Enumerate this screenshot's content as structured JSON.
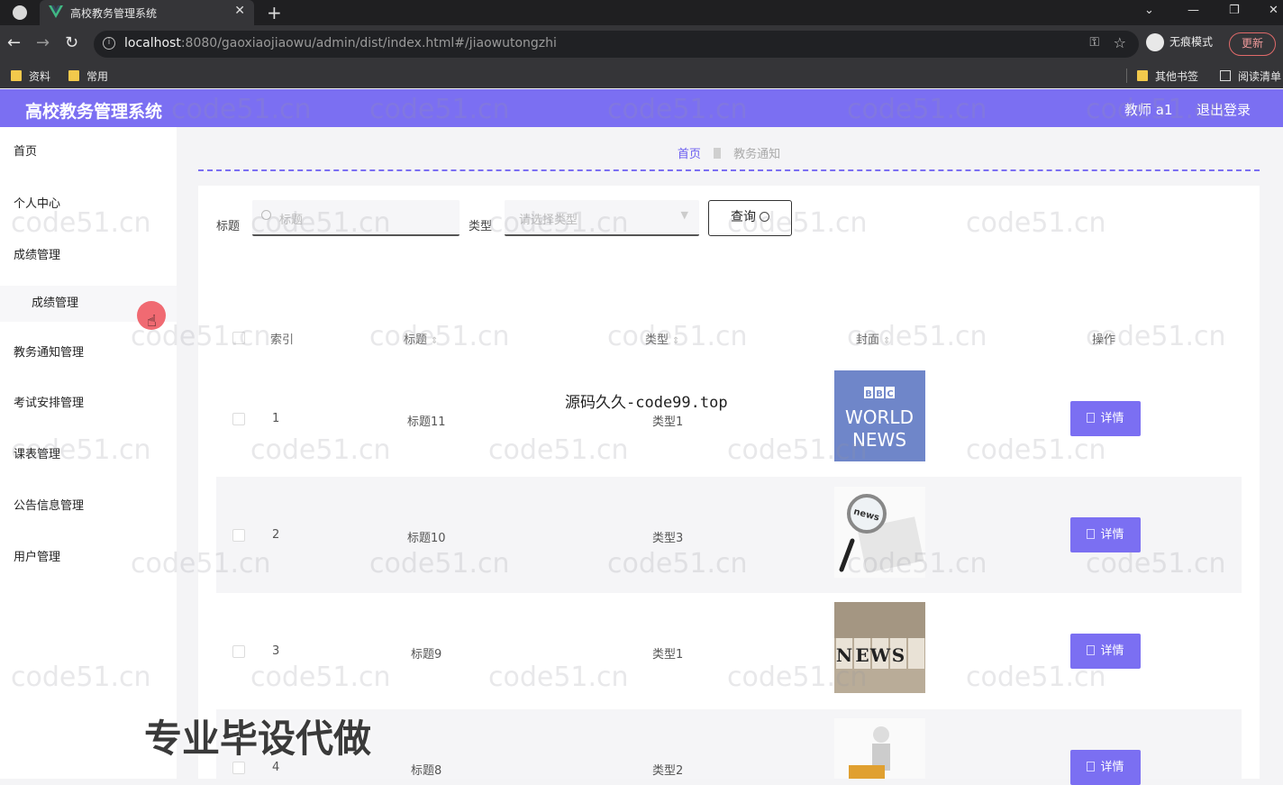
{
  "browser": {
    "tab_title": "高校教务管理系统",
    "url_host": "localhost",
    "url_path": ":8080/gaoxiaojiaowu/admin/dist/index.html#/jiaowutongzhi",
    "incognito_label": "无痕模式",
    "update_label": "更新",
    "bookmarks": [
      "资料",
      "常用"
    ],
    "other_bookmarks": "其他书签",
    "reading_list": "阅读清单"
  },
  "header": {
    "title": "高校教务管理系统",
    "user": "教师 a1",
    "logout": "退出登录",
    "accent_color": "#7b6ff2"
  },
  "sidebar": {
    "items": [
      {
        "label": "首页"
      },
      {
        "label": "个人中心"
      },
      {
        "label": "成绩管理"
      },
      {
        "label": "成绩管理"
      },
      {
        "label": "教务通知管理"
      },
      {
        "label": "考试安排管理"
      },
      {
        "label": "课表管理"
      },
      {
        "label": "公告信息管理"
      },
      {
        "label": "用户管理"
      }
    ]
  },
  "breadcrumb": {
    "home": "首页",
    "current": "教务通知"
  },
  "search": {
    "title_label": "标题",
    "title_placeholder": "标题",
    "type_label": "类型",
    "type_placeholder": "请选择类型",
    "query_button": "查询"
  },
  "table": {
    "headers": [
      "索引",
      "标题",
      "类型",
      "封面",
      "操作"
    ],
    "rows": [
      {
        "index": "1",
        "title": "标题11",
        "type": "类型1",
        "cover": "BBC WORLD NEWS",
        "action": "详情"
      },
      {
        "index": "2",
        "title": "标题10",
        "type": "类型3",
        "cover": "news magnifier",
        "action": "详情"
      },
      {
        "index": "3",
        "title": "标题9",
        "type": "类型1",
        "cover": "NEWS",
        "action": "详情"
      },
      {
        "index": "4",
        "title": "标题8",
        "type": "类型2",
        "cover": "news figure",
        "action": "详情"
      }
    ]
  },
  "overlay": {
    "watermark": "code51.cn",
    "source_text": "源码久久-code99.top",
    "promo_text": "专业毕设代做"
  }
}
